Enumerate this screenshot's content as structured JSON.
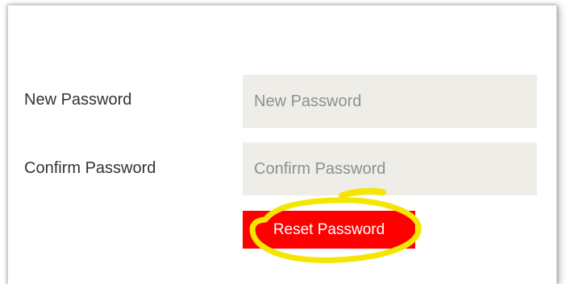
{
  "form": {
    "new_password": {
      "label": "New Password",
      "placeholder": "New Password",
      "value": ""
    },
    "confirm_password": {
      "label": "Confirm Password",
      "placeholder": "Confirm Password",
      "value": ""
    },
    "reset_button_label": "Reset Password"
  },
  "colors": {
    "input_background": "#eeede8",
    "button_background": "#ff0000",
    "annotation_highlight": "#f4e600"
  },
  "annotation": {
    "shape": "hand-drawn-yellow-ellipse",
    "target": "reset-password-button"
  }
}
